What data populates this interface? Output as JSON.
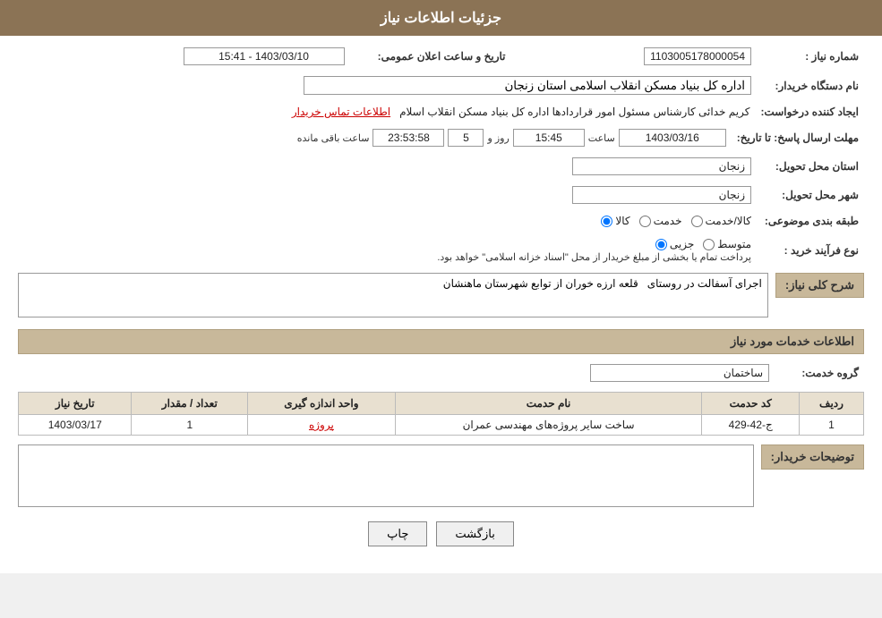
{
  "page": {
    "title": "جزئیات اطلاعات نیاز"
  },
  "header": {
    "title": "جزئیات اطلاعات نیاز"
  },
  "fields": {
    "need_number_label": "شماره نیاز :",
    "need_number_value": "1103005178000054",
    "date_label": "تاریخ و ساعت اعلان عمومی:",
    "date_value": "1403/03/10 - 15:41",
    "buyer_label": "نام دستگاه خریدار:",
    "buyer_value": "اداره کل بنیاد مسکن انقلاب اسلامی استان زنجان",
    "creator_label": "ایجاد کننده درخواست:",
    "creator_value": "کریم خدائی کارشناس مسئول امور قراردادها اداره کل بنیاد مسکن انقلاب اسلام",
    "contact_link": "اطلاعات تماس خریدار",
    "response_date_label": "مهلت ارسال پاسخ: تا تاریخ:",
    "response_date": "1403/03/16",
    "response_time_label": "ساعت",
    "response_time": "15:45",
    "response_day_label": "روز و",
    "response_day": "5",
    "response_remaining_label": "ساعت باقی مانده",
    "response_remaining": "23:53:58",
    "province_label": "استان محل تحویل:",
    "province_value": "زنجان",
    "city_label": "شهر محل تحویل:",
    "city_value": "زنجان",
    "category_label": "طبقه بندی موضوعی:",
    "category_options": [
      {
        "id": "kala",
        "label": "کالا"
      },
      {
        "id": "khadamat",
        "label": "خدمت"
      },
      {
        "id": "kala_khadamat",
        "label": "کالا/خدمت"
      }
    ],
    "category_selected": "kala",
    "purchase_type_label": "نوع فرآیند خرید :",
    "purchase_type_options": [
      {
        "id": "jozvi",
        "label": "جزیی"
      },
      {
        "id": "motavasset",
        "label": "متوسط"
      }
    ],
    "purchase_note": "پرداخت تمام یا بخشی از مبلغ خریدار از محل \"اسناد خزانه اسلامی\" خواهد بود.",
    "description_label": "شرح کلی نیاز:",
    "description_value": "اجرای آسفالت در روستای   قلعه ارزه خوران از توابع شهرستان ماهنشان",
    "services_section_label": "اطلاعات خدمات مورد نیاز",
    "service_group_label": "گروه خدمت:",
    "service_group_value": "ساختمان",
    "table": {
      "headers": [
        "ردیف",
        "کد حدمت",
        "نام حدمت",
        "واحد اندازه گیری",
        "تعداد / مقدار",
        "تاریخ نیاز"
      ],
      "rows": [
        {
          "row": "1",
          "code": "ج-42-429",
          "name": "ساخت سایر پروژه‌های مهندسی عمران",
          "unit": "پروژه",
          "quantity": "1",
          "date": "1403/03/17"
        }
      ]
    },
    "buyer_comments_label": "توضیحات خریدار:",
    "buyer_comments_value": "",
    "btn_back": "بازگشت",
    "btn_print": "چاپ"
  }
}
